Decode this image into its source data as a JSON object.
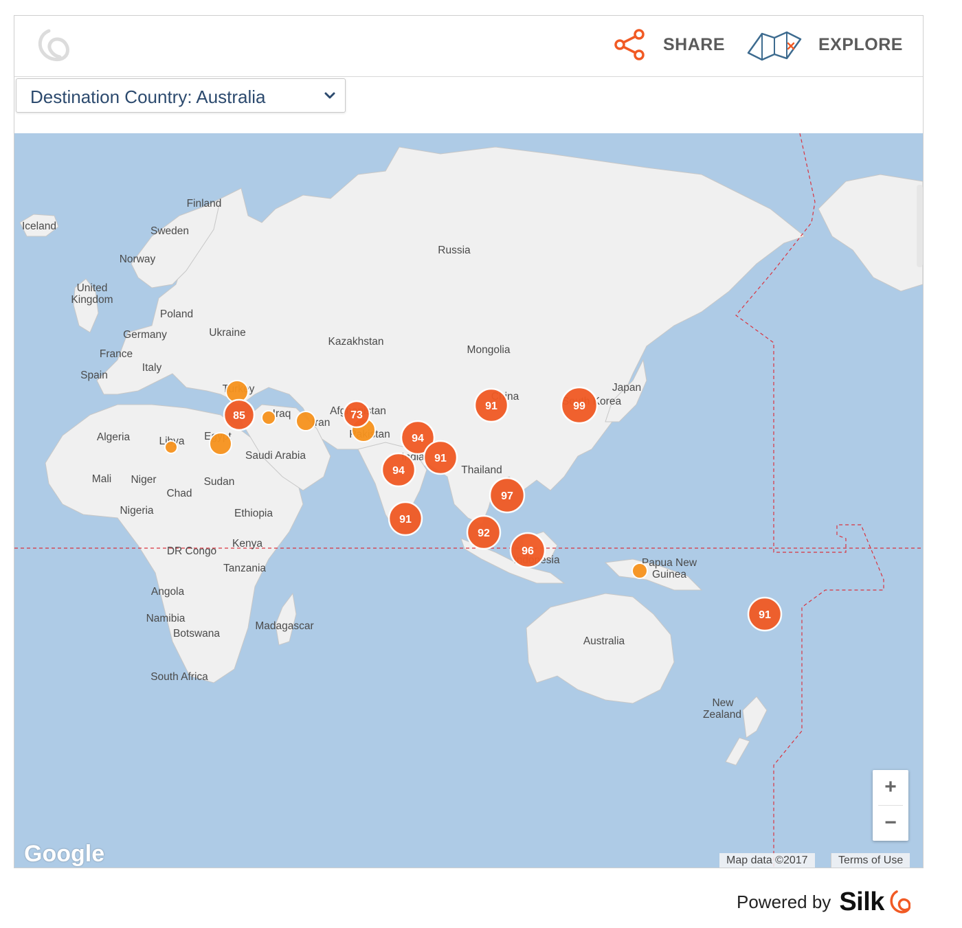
{
  "header": {
    "share_label": "SHARE",
    "explore_label": "EXPLORE"
  },
  "filter": {
    "label": "Destination Country: Australia"
  },
  "map": {
    "country_labels": [
      "Iceland",
      "Finland",
      "Sweden",
      "Norway",
      "United",
      "Kingdom",
      "Poland",
      "Germany",
      "Ukraine",
      "France",
      "Italy",
      "Spain",
      "Russia",
      "Kazakhstan",
      "Mongolia",
      "Japan",
      "Turkey",
      "Afghanistan",
      "Pakistan",
      "India",
      "Algeria",
      "Libya",
      "Egypt",
      "Saudi Arabia",
      "Mali",
      "Niger",
      "Chad",
      "Sudan",
      "Nigeria",
      "Ethiopia",
      "Kenya",
      "DR Congo",
      "Tanzania",
      "Angola",
      "Namibia",
      "Botswana",
      "South Africa",
      "Madagascar",
      "Thailand",
      "Indonesia",
      "Papua New",
      "Guinea",
      "Australia",
      "New",
      "Zealand",
      "China",
      "South Korea",
      "Iran",
      "Iraq"
    ],
    "clusters": [
      {
        "value": "85"
      },
      {
        "value": "73"
      },
      {
        "value": "94"
      },
      {
        "value": "91"
      },
      {
        "value": "94"
      },
      {
        "value": "91"
      },
      {
        "value": "91"
      },
      {
        "value": "99"
      },
      {
        "value": "97"
      },
      {
        "value": "92"
      },
      {
        "value": "96"
      },
      {
        "value": "91"
      }
    ],
    "colors": {
      "water": "#aecbe6",
      "land": "#f0f0f0",
      "cluster": "#f15a24",
      "marker": "#f7931e",
      "boundary": "#d9333f"
    },
    "zoom_in": "+",
    "zoom_out": "−",
    "google": "Google",
    "map_data": "Map data ©2017",
    "terms": "Terms of Use"
  },
  "footer": {
    "powered_by": "Powered by",
    "brand": "Silk"
  }
}
